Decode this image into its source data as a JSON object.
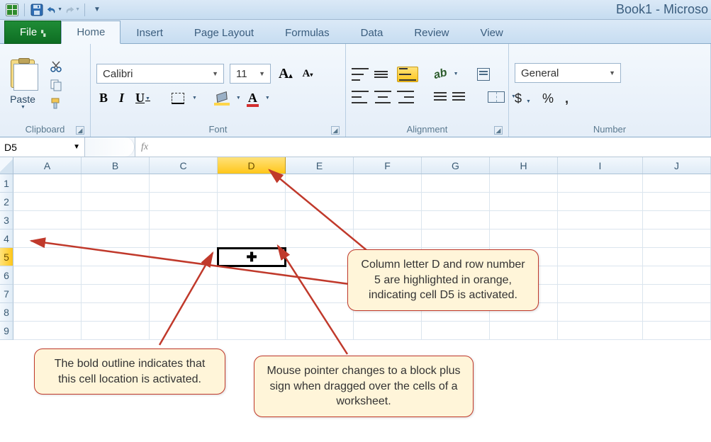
{
  "titlebar": {
    "title": "Book1 - Microso"
  },
  "tabs": {
    "file": "File",
    "items": [
      "Home",
      "Insert",
      "Page Layout",
      "Formulas",
      "Data",
      "Review",
      "View"
    ],
    "active": "Home"
  },
  "ribbon": {
    "clipboard": {
      "label": "Clipboard",
      "paste": "Paste"
    },
    "font": {
      "label": "Font",
      "name": "Calibri",
      "size": "11",
      "bold": "B",
      "italic": "I",
      "underline": "U"
    },
    "alignment": {
      "label": "Alignment"
    },
    "number": {
      "label": "Number",
      "format": "General",
      "currency": "$",
      "percent": "%",
      "comma": ","
    }
  },
  "formula_bar": {
    "cell_ref": "D5",
    "fx": "fx",
    "value": ""
  },
  "grid": {
    "columns": [
      "A",
      "B",
      "C",
      "D",
      "E",
      "F",
      "G",
      "H",
      "I",
      "J"
    ],
    "rows": [
      "1",
      "2",
      "3",
      "4",
      "5",
      "6",
      "7",
      "8",
      "9"
    ],
    "active_col": "D",
    "active_row": "5"
  },
  "callouts": {
    "c1": "Column letter D and row number 5 are highlighted in orange, indicating cell D5 is activated.",
    "c2": "The bold outline indicates that this cell location is activated.",
    "c3": "Mouse pointer changes to a block plus sign when dragged over the cells of a worksheet."
  }
}
